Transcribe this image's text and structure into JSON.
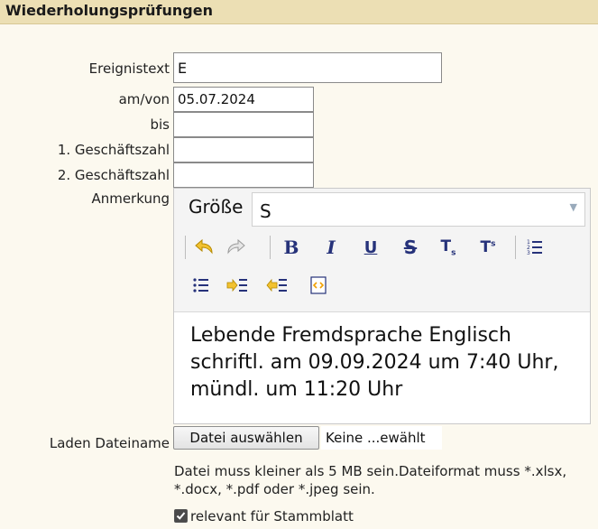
{
  "header": {
    "title": "Wiederholungsprüfungen"
  },
  "form": {
    "ereignistext": {
      "label": "Ereignistext",
      "value": "E"
    },
    "am_von": {
      "label": "am/von",
      "value": "05.07.2024"
    },
    "bis": {
      "label": "bis",
      "value": ""
    },
    "geschaeftszahl1": {
      "label": "1. Geschäftszahl",
      "value": ""
    },
    "geschaeftszahl2": {
      "label": "2. Geschäftszahl",
      "value": ""
    },
    "anmerkung": {
      "label": "Anmerkung"
    }
  },
  "editor": {
    "size_label": "Größe",
    "size_value": "S",
    "toolbar_icons": [
      "undo-icon",
      "redo-icon",
      "bold-icon",
      "italic-icon",
      "underline-icon",
      "strikethrough-icon",
      "subscript-icon",
      "superscript-icon",
      "numbered-list-icon",
      "bulleted-list-icon",
      "indent-icon",
      "outdent-icon",
      "source-icon"
    ],
    "content_lines": [
      "Lebende Fremdsprache Englisch",
      "schriftl. am 09.09.2024 um 7:40 Uhr,",
      "mündl. um 11:20 Uhr"
    ]
  },
  "upload": {
    "label": "Laden Dateiname",
    "button_label": "Datei auswählen",
    "status": "Keine ...ewählt",
    "hint": "Datei muss kleiner als 5 MB sein.Dateiformat muss *.xlsx, *.docx, *.pdf oder *.jpeg sein."
  },
  "stammblatt": {
    "label": "relevant für Stammblatt",
    "checked": true
  }
}
